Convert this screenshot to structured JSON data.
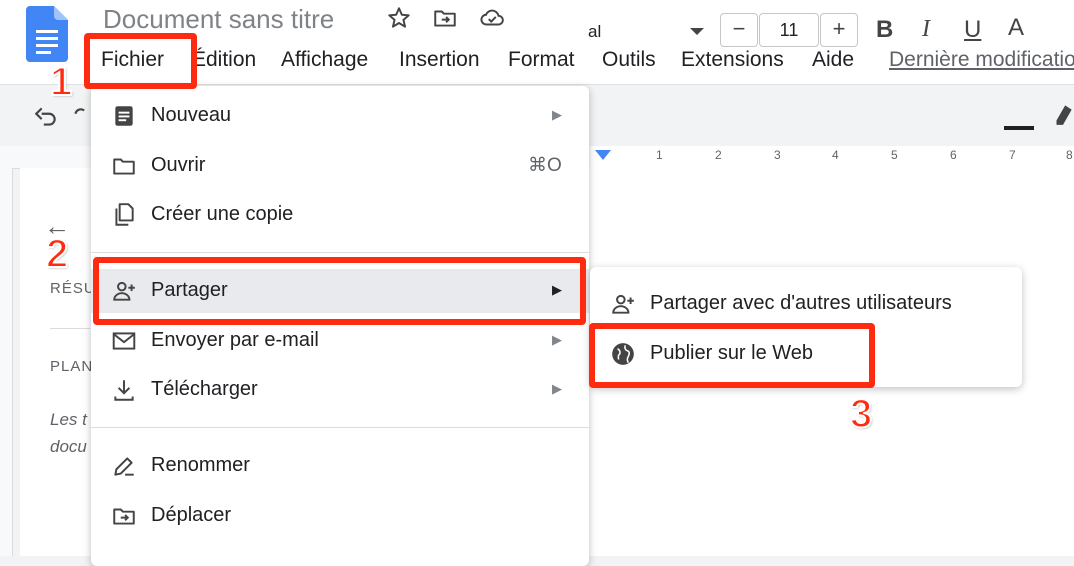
{
  "header": {
    "title": "Document sans titre"
  },
  "menubar": {
    "fichier": "Fichier",
    "edition": "Édition",
    "affichage": "Affichage",
    "insertion": "Insertion",
    "format": "Format",
    "outils": "Outils",
    "extensions": "Extensions",
    "aide": "Aide",
    "last_modified": "Dernière modification"
  },
  "toolbar": {
    "font_name": "al",
    "font_size": "11",
    "minus": "−",
    "plus": "+",
    "bold": "B",
    "italic": "I",
    "underline": "U",
    "text_color": "A"
  },
  "ruler": {
    "ticks": [
      "1",
      "2",
      "3",
      "4",
      "5",
      "6",
      "7",
      "8"
    ]
  },
  "outline": {
    "resume": "RÉSU",
    "plan": "PLAN",
    "note_line1": "Les t",
    "note_line2": "docu"
  },
  "file_menu": {
    "items": [
      {
        "label": "Nouveau",
        "icon": "doc-icon",
        "has_submenu": true
      },
      {
        "label": "Ouvrir",
        "icon": "folder-icon",
        "shortcut": "⌘O"
      },
      {
        "label": "Créer une copie",
        "icon": "copy-icon"
      },
      {
        "label": "Partager",
        "icon": "person-add-icon",
        "has_submenu": true
      },
      {
        "label": "Envoyer par e-mail",
        "icon": "mail-icon",
        "has_submenu": true
      },
      {
        "label": "Télécharger",
        "icon": "download-icon",
        "has_submenu": true
      },
      {
        "label": "Renommer",
        "icon": "rename-icon"
      },
      {
        "label": "Déplacer",
        "icon": "move-folder-icon"
      }
    ]
  },
  "share_submenu": {
    "items": [
      {
        "label": "Partager avec d'autres utilisateurs",
        "icon": "person-add-icon"
      },
      {
        "label": "Publier sur le Web",
        "icon": "globe-icon"
      }
    ]
  },
  "annotations": {
    "step1": "1",
    "step2": "2",
    "step3": "3",
    "color": "#ff2b10"
  },
  "colors": {
    "docs_blue": "#4285f4",
    "menu_highlight": "#e8eaed"
  }
}
